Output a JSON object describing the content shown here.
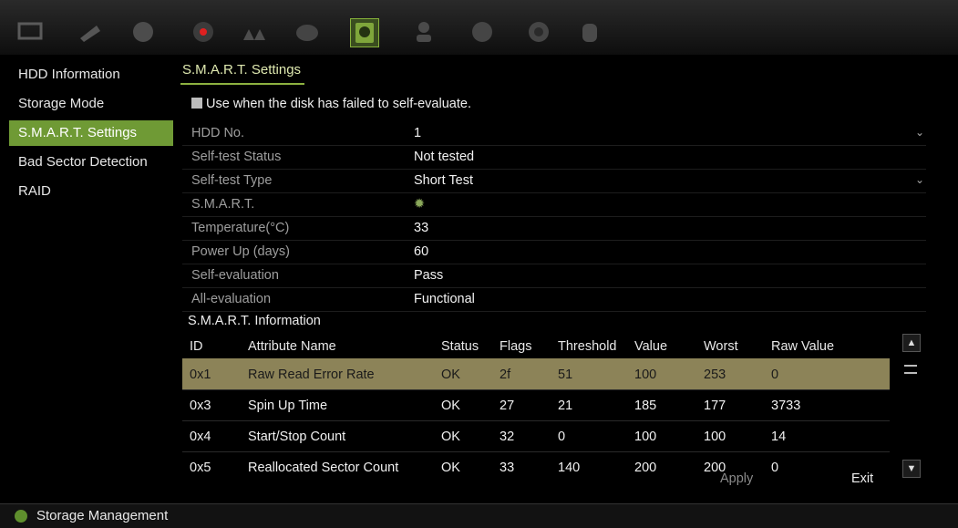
{
  "sidebar": {
    "items": [
      {
        "label": "HDD Information"
      },
      {
        "label": "Storage Mode"
      },
      {
        "label": "S.M.A.R.T. Settings"
      },
      {
        "label": "Bad Sector Detection"
      },
      {
        "label": "RAID"
      }
    ],
    "active_index": 2
  },
  "tab": {
    "label": "S.M.A.R.T. Settings"
  },
  "checkbox": {
    "label": "Use when the disk has failed to self-evaluate."
  },
  "fields": [
    {
      "label": "HDD No.",
      "value": "1"
    },
    {
      "label": "Self-test Status",
      "value": "Not tested"
    },
    {
      "label": "Self-test Type",
      "value": "Short Test"
    },
    {
      "label": "S.M.A.R.T.",
      "value": ""
    },
    {
      "label": "Temperature(°C)",
      "value": "33"
    },
    {
      "label": "Power Up (days)",
      "value": "60"
    },
    {
      "label": "Self-evaluation",
      "value": "Pass"
    },
    {
      "label": "All-evaluation",
      "value": "Functional"
    }
  ],
  "smart_info": {
    "title": "S.M.A.R.T. Information",
    "columns": [
      "ID",
      "Attribute Name",
      "Status",
      "Flags",
      "Threshold",
      "Value",
      "Worst",
      "Raw Value"
    ],
    "rows": [
      [
        "0x1",
        "Raw Read Error Rate",
        "OK",
        "2f",
        "51",
        "100",
        "253",
        "0"
      ],
      [
        "0x3",
        "Spin Up Time",
        "OK",
        "27",
        "21",
        "185",
        "177",
        "3733"
      ],
      [
        "0x4",
        "Start/Stop Count",
        "OK",
        "32",
        "0",
        "100",
        "100",
        "14"
      ],
      [
        "0x5",
        "Reallocated Sector Count",
        "OK",
        "33",
        "140",
        "200",
        "200",
        "0"
      ]
    ]
  },
  "buttons": {
    "apply": "Apply",
    "exit": "Exit"
  },
  "status": {
    "text": "Storage Management"
  },
  "icons": [
    "monitor-icon",
    "camera-icon",
    "ptz-icon",
    "record-icon",
    "alarm-icon",
    "network-icon",
    "hdd-icon",
    "user-icon",
    "system-icon",
    "info-icon",
    "maintenance-icon"
  ],
  "colors": {
    "accent": "#6f9a35",
    "selected_row": "#8c8358"
  }
}
